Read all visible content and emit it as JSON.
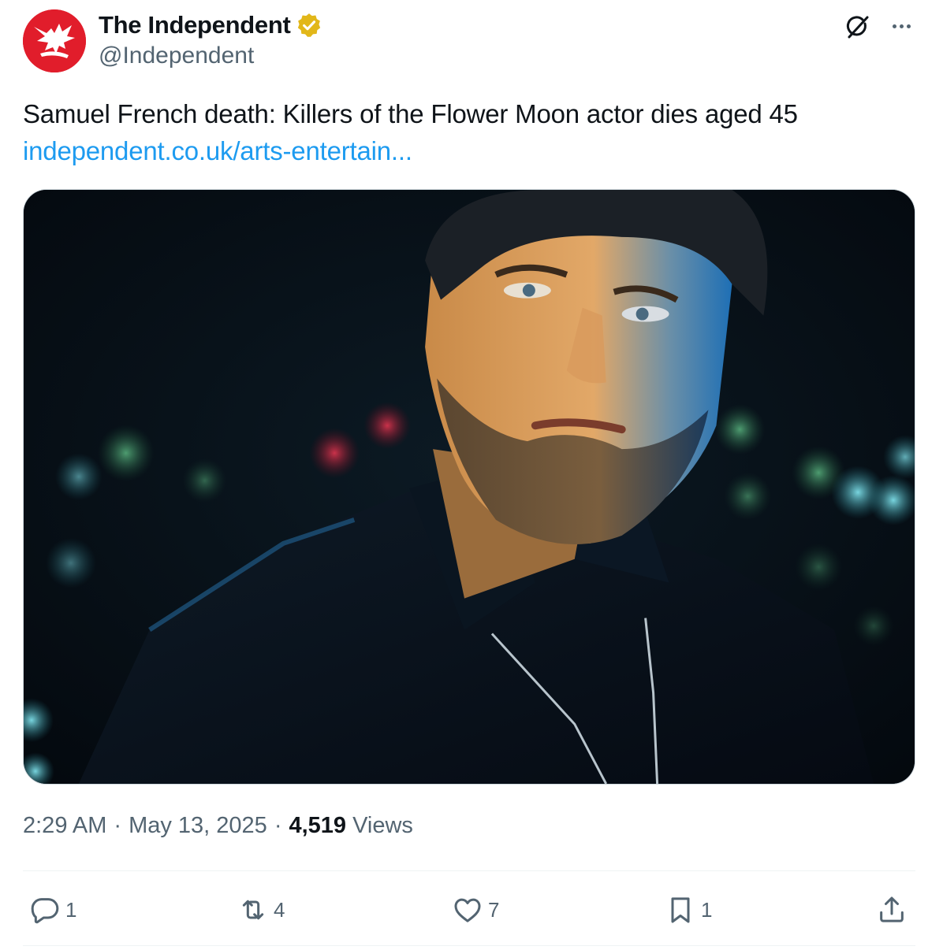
{
  "author": {
    "display_name": "The Independent",
    "handle": "@Independent",
    "avatar_icon": "eagle-logo",
    "verified_icon": "gold-verified-badge",
    "brand_color": "#e11d2b",
    "verified_color": "#e2b719"
  },
  "header_actions": {
    "grok_icon": "grok-icon",
    "more_icon": "more-options-icon"
  },
  "tweet": {
    "text": "Samuel French death: Killers of the Flower Moon actor dies aged 45",
    "link_text": "independent.co.uk/arts-entertain...",
    "link_color": "#1d9bf0"
  },
  "media": {
    "kind": "photo"
  },
  "meta": {
    "time": "2:29 AM",
    "separator": "·",
    "date": "May 13, 2025",
    "views_count": "4,519",
    "views_label": "Views"
  },
  "actions": {
    "reply": {
      "icon": "reply-icon",
      "count": "1"
    },
    "repost": {
      "icon": "repost-icon",
      "count": "4"
    },
    "like": {
      "icon": "heart-icon",
      "count": "7"
    },
    "bookmark": {
      "icon": "bookmark-icon",
      "count": "1"
    },
    "share": {
      "icon": "share-icon"
    }
  }
}
